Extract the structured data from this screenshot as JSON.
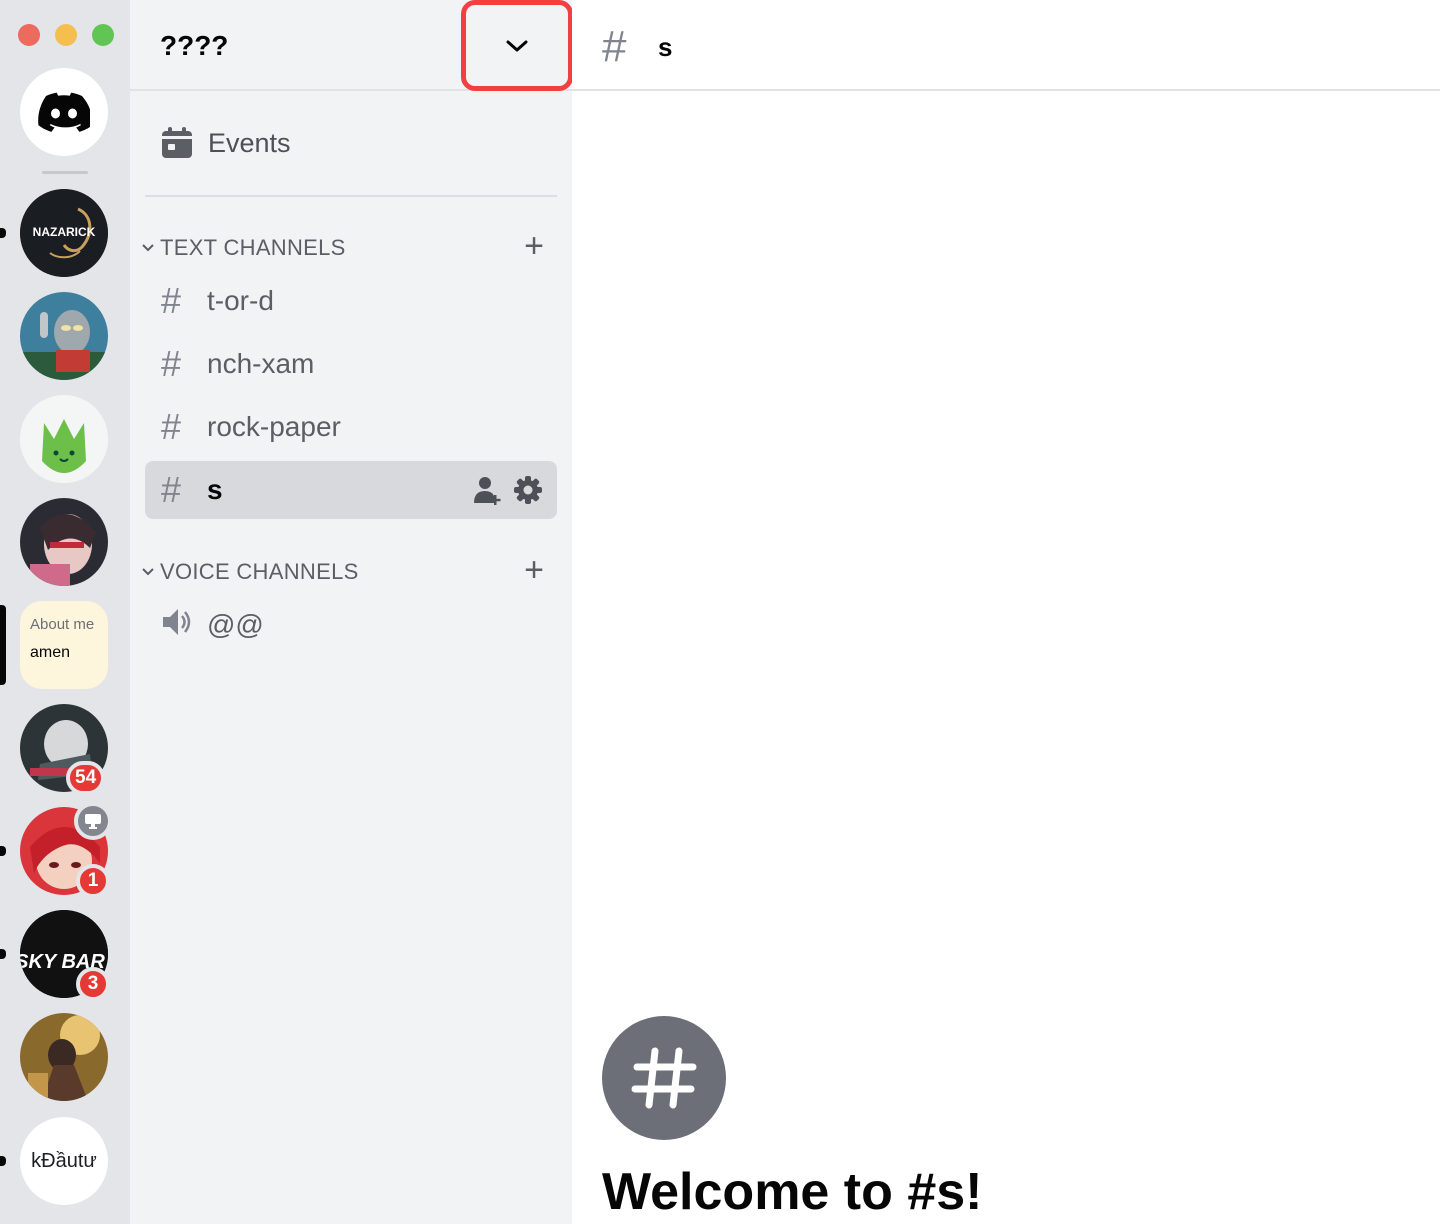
{
  "server": {
    "name": "????"
  },
  "rail": {
    "about_me_title": "About me",
    "about_me_name": "amen",
    "nazarick_text": "NAZARICK",
    "skybar_text": "SKY BAR",
    "kdautu_text": "kĐầutư",
    "badges": {
      "server6": "54",
      "server7": "1",
      "server8": "3"
    }
  },
  "sidebar": {
    "events_label": "Events",
    "text_category": "TEXT CHANNELS",
    "voice_category": "VOICE CHANNELS",
    "text_channels": [
      "t-or-d",
      "nch-xam",
      "rock-paper",
      "s"
    ],
    "voice_channels": [
      "@@"
    ]
  },
  "main": {
    "channel_name": "s",
    "welcome_title": "Welcome to #s!"
  },
  "colors": {
    "highlight": "#f23f42",
    "unread_badge": "#e53935",
    "discord_blurple": "#5865f2"
  }
}
